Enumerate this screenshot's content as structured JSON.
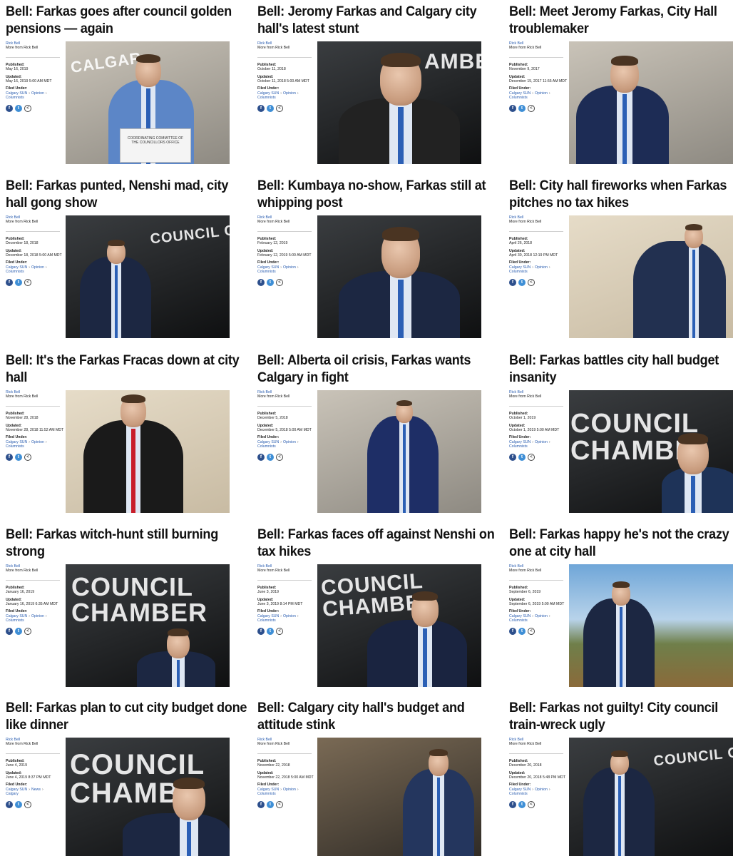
{
  "cards": [
    {
      "headline": "Bell: Farkas goes after council golden pensions — again",
      "author": "Rick Bell",
      "more": "More from Rick Bell",
      "published_label": "Published:",
      "published": "May 16, 2019",
      "updated_label": "Updated:",
      "updated": "May 16, 2019 5:00 AM MDT",
      "filed_label": "Filed Under:",
      "filed": [
        "Calgary SUN",
        "Opinion",
        "Columnists"
      ],
      "photo_text": "CALGAR",
      "photo_caption": "COORDINATING COMMITTEE OF THE COUNCILLORS OFFICE"
    },
    {
      "headline": "Bell: Jeromy Farkas and Calgary city hall's latest stunt",
      "author": "Rick Bell",
      "more": "More from Rick Bell",
      "published_label": "Published:",
      "published": "October 11, 2018",
      "updated_label": "Updated:",
      "updated": "October 11, 2018 5:00 AM MDT",
      "filed_label": "Filed Under:",
      "filed": [
        "Calgary SUN",
        "Opinion",
        "Columnists"
      ],
      "photo_text": "AMBE",
      "photo_caption": ""
    },
    {
      "headline": "Bell: Meet Jeromy Farkas, City Hall troublemaker",
      "author": "Rick Bell",
      "more": "More from Rick Bell",
      "published_label": "Published:",
      "published": "November 9, 2017",
      "updated_label": "Updated:",
      "updated": "December 15, 2017 11:55 AM MDT",
      "filed_label": "Filed Under:",
      "filed": [
        "Calgary SUN",
        "Opinion",
        "Columnists"
      ],
      "photo_text": "",
      "photo_caption": ""
    },
    {
      "headline": "Bell: Farkas punted, Nenshi mad, city hall gong show",
      "author": "Rick Bell",
      "more": "More from Rick Bell",
      "published_label": "Published:",
      "published": "December 18, 2018",
      "updated_label": "Updated:",
      "updated": "December 18, 2018 5:00 AM MDT",
      "filed_label": "Filed Under:",
      "filed": [
        "Calgary SUN",
        "Opinion",
        "Columnists"
      ],
      "photo_text": "COUNCIL CHAMBER",
      "photo_caption": ""
    },
    {
      "headline": "Bell: Kumbaya no-show, Farkas still at whipping post",
      "author": "Rick Bell",
      "more": "More from Rick Bell",
      "published_label": "Published:",
      "published": "February 12, 2019",
      "updated_label": "Updated:",
      "updated": "February 12, 2019 5:00 AM MDT",
      "filed_label": "Filed Under:",
      "filed": [
        "Calgary SUN",
        "Opinion",
        "Columnists"
      ],
      "photo_text": "",
      "photo_caption": ""
    },
    {
      "headline": "Bell: City hall fireworks when Farkas pitches no tax hikes",
      "author": "Rick Bell",
      "more": "More from Rick Bell",
      "published_label": "Published:",
      "published": "April 26, 2018",
      "updated_label": "Updated:",
      "updated": "April 30, 2018 12:19 PM MDT",
      "filed_label": "Filed Under:",
      "filed": [
        "Calgary SUN",
        "Opinion",
        "Columnists"
      ],
      "photo_text": "",
      "photo_caption": ""
    },
    {
      "headline": "Bell: It's the Farkas Fracas down at city hall",
      "author": "Rick Bell",
      "more": "More from Rick Bell",
      "published_label": "Published:",
      "published": "November 28, 2018",
      "updated_label": "Updated:",
      "updated": "November 28, 2018 11:52 AM MDT",
      "filed_label": "Filed Under:",
      "filed": [
        "Calgary SUN",
        "Opinion",
        "Columnists"
      ],
      "photo_text": "",
      "photo_caption": ""
    },
    {
      "headline": "Bell: Alberta oil crisis, Farkas wants Calgary in fight",
      "author": "Rick Bell",
      "more": "More from Rick Bell",
      "published_label": "Published:",
      "published": "December 5, 2018",
      "updated_label": "Updated:",
      "updated": "December 5, 2018 5:00 AM MDT",
      "filed_label": "Filed Under:",
      "filed": [
        "Calgary SUN",
        "Opinion",
        "Columnists"
      ],
      "photo_text": "",
      "photo_caption": ""
    },
    {
      "headline": "Bell: Farkas battles city hall budget insanity",
      "author": "Rick Bell",
      "more": "More from Rick Bell",
      "published_label": "Published:",
      "published": "October 1, 2019",
      "updated_label": "Updated:",
      "updated": "October 1, 2019 5:00 AM MDT",
      "filed_label": "Filed Under:",
      "filed": [
        "Calgary SUN",
        "Opinion",
        "Columnists"
      ],
      "photo_text": "COUNCIL CHAMBE",
      "photo_caption": ""
    },
    {
      "headline": "Bell: Farkas witch-hunt still burning strong",
      "author": "Rick Bell",
      "more": "More from Rick Bell",
      "published_label": "Published:",
      "published": "January 16, 2019",
      "updated_label": "Updated:",
      "updated": "January 16, 2019 6:35 AM MDT",
      "filed_label": "Filed Under:",
      "filed": [
        "Calgary SUN",
        "Opinion",
        "Columnists"
      ],
      "photo_text": "COUNCIL CHAMBER",
      "photo_caption": ""
    },
    {
      "headline": "Bell: Farkas faces off against Nenshi on tax hikes",
      "author": "Rick Bell",
      "more": "More from Rick Bell",
      "published_label": "Published:",
      "published": "June 3, 2019",
      "updated_label": "Updated:",
      "updated": "June 3, 2019 8:14 PM MDT",
      "filed_label": "Filed Under:",
      "filed": [
        "Calgary SUN",
        "Opinion",
        "Columnists"
      ],
      "photo_text": "COUNCIL CHAMBER",
      "photo_caption": ""
    },
    {
      "headline": "Bell: Farkas happy he's not the crazy one at city hall",
      "author": "Rick Bell",
      "more": "More from Rick Bell",
      "published_label": "Published:",
      "published": "September 6, 2019",
      "updated_label": "Updated:",
      "updated": "September 6, 2019 5:00 AM MDT",
      "filed_label": "Filed Under:",
      "filed": [
        "Calgary SUN",
        "Opinion",
        "Columnists"
      ],
      "photo_text": "",
      "photo_caption": ""
    },
    {
      "headline": "Bell: Farkas plan to cut city budget done like dinner",
      "author": "Rick Bell",
      "more": "More from Rick Bell",
      "published_label": "Published:",
      "published": "June 4, 2019",
      "updated_label": "Updated:",
      "updated": "June 4, 2019 8:37 PM MDT",
      "filed_label": "Filed Under:",
      "filed": [
        "Calgary SUN",
        "News",
        "Calgary"
      ],
      "photo_text": "COUNCIL CHAMBE",
      "photo_caption": ""
    },
    {
      "headline": "Bell: Calgary city hall's budget and attitude stink",
      "author": "Rick Bell",
      "more": "More from Rick Bell",
      "published_label": "Published:",
      "published": "November 22, 2018",
      "updated_label": "Updated:",
      "updated": "November 22, 2018 5:00 AM MDT",
      "filed_label": "Filed Under:",
      "filed": [
        "Calgary SUN",
        "Opinion",
        "Columnists"
      ],
      "photo_text": "",
      "photo_caption": ""
    },
    {
      "headline": "Bell: Farkas not guilty! City council train-wreck ugly",
      "author": "Rick Bell",
      "more": "More from Rick Bell",
      "published_label": "Published:",
      "published": "December 20, 2018",
      "updated_label": "Updated:",
      "updated": "December 20, 2018 5:48 PM MDT",
      "filed_label": "Filed Under:",
      "filed": [
        "Calgary SUN",
        "Opinion",
        "Columnists"
      ],
      "photo_text": "COUNCIL CHAMBER",
      "photo_caption": ""
    }
  ],
  "social_icons": [
    "facebook-icon",
    "twitter-icon",
    "share-icon"
  ],
  "colors": {
    "link": "#2a5db0",
    "facebook": "#2d4f8c",
    "twitter": "#3f8fd6"
  }
}
